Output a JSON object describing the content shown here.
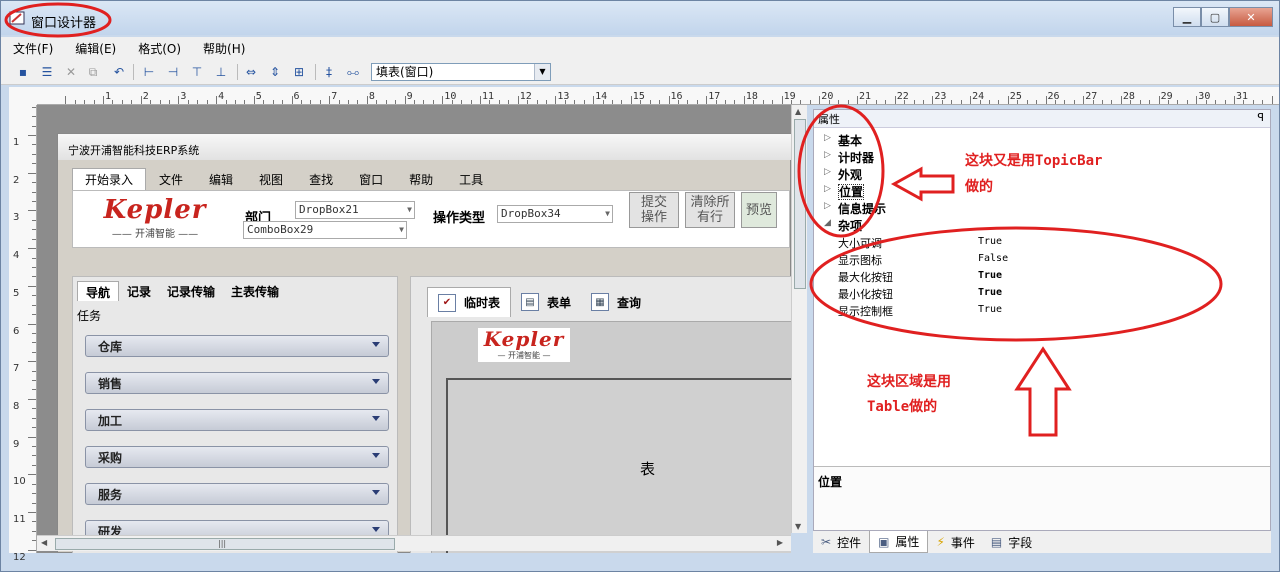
{
  "window": {
    "title": "窗口设计器",
    "min": "▁",
    "max": "▢",
    "close": "✕"
  },
  "menu": [
    "文件(F)",
    "编辑(E)",
    "格式(O)",
    "帮助(H)"
  ],
  "toolbar": {
    "dropdown_value": "填表(窗口)"
  },
  "ruler": {
    "h": [
      "1",
      "2",
      "3",
      "4",
      "5",
      "6",
      "7",
      "8",
      "9",
      "10",
      "11",
      "12",
      "13",
      "14",
      "15",
      "16",
      "17",
      "18",
      "19",
      "20",
      "21",
      "22",
      "23",
      "24",
      "25",
      "26",
      "27",
      "28",
      "29",
      "30",
      "31"
    ],
    "v": [
      "1",
      "2",
      "3",
      "4",
      "5",
      "6",
      "7",
      "8",
      "9",
      "10",
      "11",
      "12"
    ]
  },
  "form": {
    "title": "宁波开浦智能科技ERP系统",
    "menu": [
      "开始录入",
      "文件",
      "编辑",
      "视图",
      "查找",
      "窗口",
      "帮助",
      "工具"
    ],
    "logo": {
      "text": "Kepler",
      "sub": "—— 开浦智能 ——"
    },
    "dept_label": "部门",
    "dept_dropdown": "DropBox21",
    "dept_combo": "ComboBox29",
    "op_label": "操作类型",
    "op_dropdown": "DropBox34",
    "buttons": [
      {
        "label": "提交\n操作"
      },
      {
        "label": "清除所\n有行"
      },
      {
        "label": "预览"
      }
    ],
    "left_tabs": [
      "导航",
      "记录",
      "记录传输",
      "主表传输"
    ],
    "task_label": "任务",
    "nav_items": [
      "仓库",
      "销售",
      "加工",
      "采购",
      "服务",
      "研发"
    ],
    "right_tabs": [
      "临时表",
      "表单",
      "查询"
    ],
    "logo_small": {
      "text": "Kepler",
      "sub": "— 开浦智能 —"
    },
    "table_label": "表"
  },
  "properties": {
    "header": "属性",
    "categories": [
      "基本",
      "计时器",
      "外观",
      "位置",
      "信息提示",
      "杂项"
    ],
    "rows": [
      {
        "key": "大小可调",
        "value": "True",
        "bold": false
      },
      {
        "key": "显示图标",
        "value": "False",
        "bold": false
      },
      {
        "key": "最大化按钮",
        "value": "True",
        "bold": true
      },
      {
        "key": "最小化按钮",
        "value": "True",
        "bold": true
      },
      {
        "key": "显示控制框",
        "value": "True",
        "bold": false
      }
    ],
    "description_title": "位置"
  },
  "bottom_tabs": [
    "控件",
    "属性",
    "事件",
    "字段"
  ],
  "annotations": {
    "a1_line1": "这块又是用TopicBar",
    "a1_line2": "做的",
    "a2_line1": "这块区域是用",
    "a2_line2": "Table做的"
  },
  "colors": {
    "annotation": "#e02020",
    "brand": "#c8241e"
  }
}
